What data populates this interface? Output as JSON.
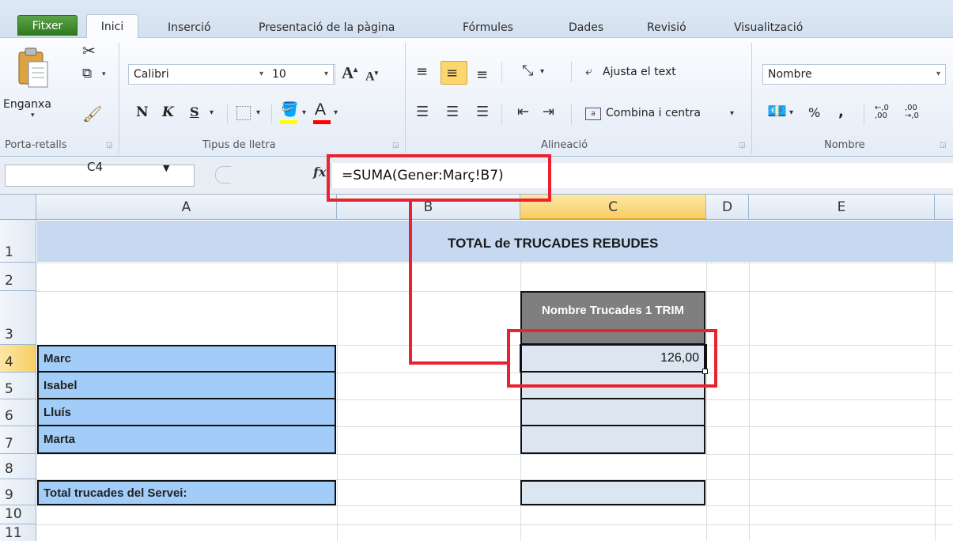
{
  "ribbon_tabs": {
    "file": "Fitxer",
    "home": "Inici",
    "insert": "Inserció",
    "page_layout": "Presentació de la pàgina",
    "formulas": "Fórmules",
    "data": "Dades",
    "review": "Revisió",
    "view": "Visualització"
  },
  "clipboard": {
    "paste_label": "Enganxa",
    "group_label": "Porta-retalls"
  },
  "font": {
    "family": "Calibri",
    "size": "10",
    "bold": "N",
    "italic": "K",
    "underline": "S",
    "group_label": "Tipus de lletra"
  },
  "alignment": {
    "wrap_text": "Ajusta el text",
    "merge_center": "Combina i centra",
    "group_label": "Alineació"
  },
  "number": {
    "format": "Nombre",
    "percent": "%",
    "comma": ",",
    "increase_decimal": "←,0 ,00",
    "decrease_decimal": ",00 →,0",
    "group_label": "Nombre"
  },
  "formula_bar": {
    "name_box": "C4",
    "fx": "fx",
    "formula": "=SUMA(Gener:Març!B7)"
  },
  "columns": [
    "A",
    "B",
    "C",
    "D",
    "E"
  ],
  "rows": [
    "1",
    "2",
    "3",
    "4",
    "5",
    "6",
    "7",
    "8",
    "9",
    "10",
    "11"
  ],
  "sheet": {
    "title": "TOTAL de TRUCADES REBUDES",
    "header_c3": "Nombre Trucades 1 TRIM",
    "names": [
      "Marc",
      "Isabel",
      "Lluís",
      "Marta"
    ],
    "total_label": "Total trucades del Servei:",
    "c4_value": "126,00"
  },
  "colors": {
    "title_fill": "#c6d9f1",
    "name_fill": "#a2cdf8",
    "value_fill": "#dce6f1",
    "header_fill": "#7f7f7f",
    "callout": "#e8222e"
  }
}
